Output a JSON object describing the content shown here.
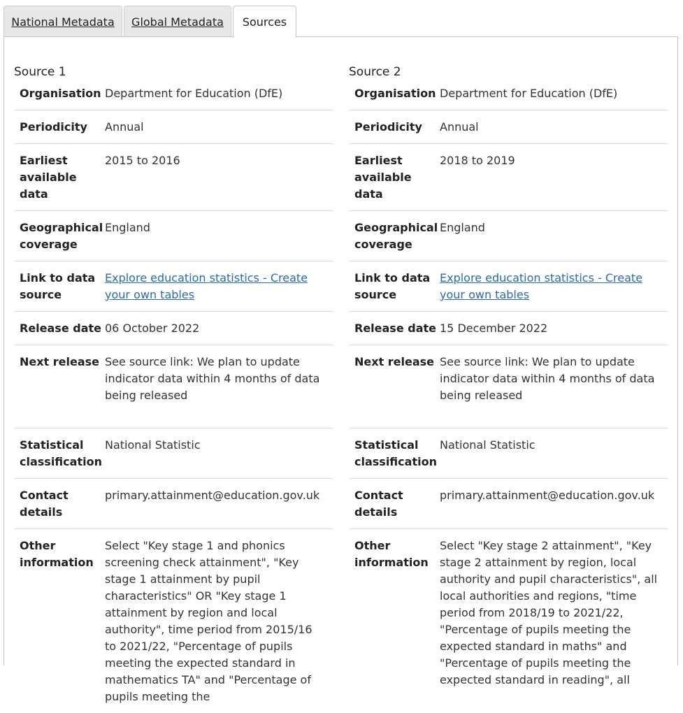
{
  "tabs": [
    {
      "label": "National Metadata",
      "active": false
    },
    {
      "label": "Global Metadata",
      "active": false
    },
    {
      "label": "Sources",
      "active": true
    }
  ],
  "sources": [
    {
      "title": "Source 1",
      "rows": [
        {
          "label": "Organisation",
          "value": "Department for Education (DfE)"
        },
        {
          "label": "Periodicity",
          "value": "Annual"
        },
        {
          "label": "Earliest available data",
          "value": "2015 to 2016"
        },
        {
          "label": "Geographical coverage",
          "value": "England"
        },
        {
          "label": "Link to data source",
          "value": "Explore education statistics - Create your own tables"
        },
        {
          "label": "Release date",
          "value": "06 October 2022"
        },
        {
          "label": "Next release",
          "value": "See source link: We plan to update indicator data within 4 months of data being released"
        },
        {
          "label": "Statistical classification",
          "value": "National Statistic"
        },
        {
          "label": "Contact details",
          "value": "primary.attainment@education.gov.uk"
        },
        {
          "label": "Other information",
          "value": "Select \"Key stage 1 and phonics screening check attainment\", \"Key stage 1 attainment by pupil characteristics\" OR \"Key stage 1 attainment by region and local authority\", time period from 2015/16 to 2021/22, \"Percentage of pupils meeting the expected standard in mathematics TA\" and \"Percentage of pupils meeting the"
        }
      ]
    },
    {
      "title": "Source 2",
      "rows": [
        {
          "label": "Organisation",
          "value": "Department for Education (DfE)"
        },
        {
          "label": "Periodicity",
          "value": "Annual"
        },
        {
          "label": "Earliest available data",
          "value": "2018 to 2019"
        },
        {
          "label": "Geographical coverage",
          "value": "England"
        },
        {
          "label": "Link to data source",
          "value": "Explore education statistics - Create your own tables"
        },
        {
          "label": "Release date",
          "value": "15 December 2022"
        },
        {
          "label": "Next release",
          "value": "See source link: We plan to update indicator data within 4 months of data being released"
        },
        {
          "label": "Statistical classification",
          "value": "National Statistic"
        },
        {
          "label": "Contact details",
          "value": "primary.attainment@education.gov.uk"
        },
        {
          "label": "Other information",
          "value": "Select \"Key stage 2 attainment\", \"Key stage 2 attainment by region, local authority and pupil characteristics\", all local authorities and regions, \"time period from 2018/19 to 2021/22, \"Percentage of pupils meeting the expected standard in maths\" and \"Percentage of pupils meeting the expected standard in reading\", all"
        }
      ]
    }
  ],
  "colors": {
    "link": "#2a6ab0",
    "border": "#dddddd",
    "tab_bg": "#e8e8e8"
  }
}
